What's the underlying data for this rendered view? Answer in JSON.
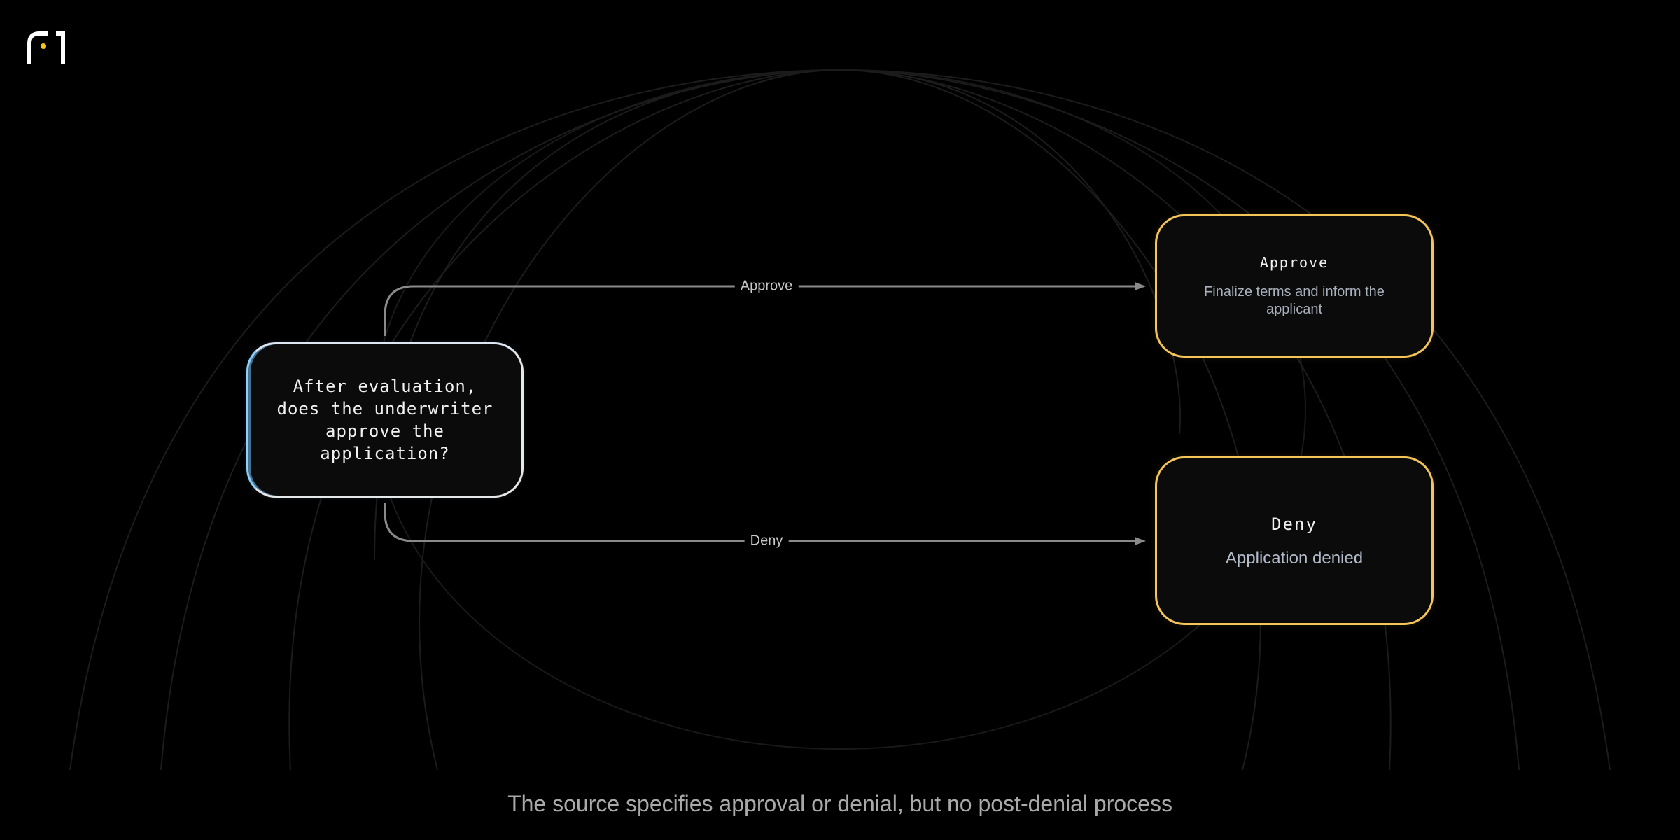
{
  "decision": {
    "line1": "After evaluation,",
    "line2": "does the underwriter",
    "line3": "approve the",
    "line4": "application?"
  },
  "edges": {
    "approve_label": "Approve",
    "deny_label": "Deny"
  },
  "outcomes": {
    "approve": {
      "title": "Approve",
      "description_line1": "Finalize terms and inform the",
      "description_line2": "applicant"
    },
    "deny": {
      "title": "Deny",
      "description": "Application denied"
    }
  },
  "caption": "The source specifies approval or denial, but no post-denial process",
  "colors": {
    "background": "#000000",
    "outcome_border": "#f5c55a",
    "decision_border": "#e8e8e8",
    "connector": "#8a8a8a",
    "logo_accent": "#f5c518"
  },
  "icons": {
    "logo": "brand-logo-icon",
    "arrowhead": "arrowhead-icon"
  }
}
